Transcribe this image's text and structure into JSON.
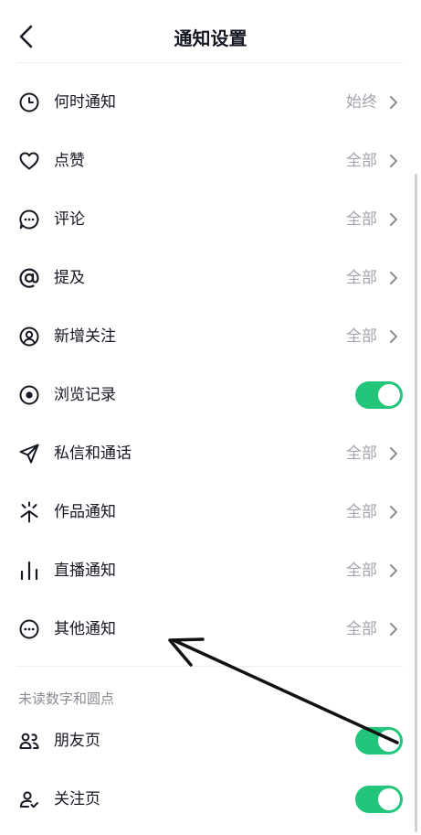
{
  "header": {
    "title": "通知设置"
  },
  "items": [
    {
      "label": "何时通知",
      "value": "始终"
    },
    {
      "label": "点赞",
      "value": "全部"
    },
    {
      "label": "评论",
      "value": "全部"
    },
    {
      "label": "提及",
      "value": "全部"
    },
    {
      "label": "新增关注",
      "value": "全部"
    },
    {
      "label": "浏览记录",
      "toggle": true
    },
    {
      "label": "私信和通话",
      "value": "全部"
    },
    {
      "label": "作品通知",
      "value": "全部"
    },
    {
      "label": "直播通知",
      "value": "全部"
    },
    {
      "label": "其他通知",
      "value": "全部"
    }
  ],
  "section": {
    "label": "未读数字和圆点",
    "items": [
      {
        "label": "朋友页",
        "toggle": true
      },
      {
        "label": "关注页",
        "toggle": true
      }
    ]
  },
  "colors": {
    "accent": "#22c57a",
    "muted": "#a2a4ab"
  }
}
